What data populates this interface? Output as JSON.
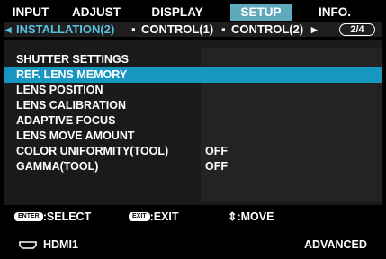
{
  "tabs": [
    "INPUT",
    "ADJUST",
    "DISPLAY",
    "SETUP",
    "INFO."
  ],
  "subnav": {
    "left_arrow": "◂",
    "current": "INSTALLATION(2)",
    "sep1": "▪",
    "item2": "CONTROL(1)",
    "sep2": "▪",
    "item3": "CONTROL(2)",
    "right_arrow": "▸",
    "page": "2/4"
  },
  "items": [
    {
      "label": "SHUTTER SETTINGS",
      "value": ""
    },
    {
      "label": "REF. LENS MEMORY",
      "value": ""
    },
    {
      "label": "LENS POSITION",
      "value": ""
    },
    {
      "label": "LENS CALIBRATION",
      "value": ""
    },
    {
      "label": "ADAPTIVE FOCUS",
      "value": ""
    },
    {
      "label": "LENS MOVE AMOUNT",
      "value": ""
    },
    {
      "label": "COLOR UNIFORMITY(TOOL)",
      "value": "OFF"
    },
    {
      "label": "GAMMA(TOOL)",
      "value": "OFF"
    }
  ],
  "footer": {
    "enter_key": "ENTER",
    "select": ":SELECT",
    "exit_key": "EXIT",
    "exit": ":EXIT",
    "move_icon": "⇕",
    "move": ":MOVE"
  },
  "status": {
    "input_icon": "hdmi-icon",
    "input": "HDMI1",
    "mode": "ADVANCED"
  },
  "colors": {
    "active_tab": "#5fa9bf",
    "selected_row": "#1797bf",
    "sub_text": "#57c1e0"
  }
}
